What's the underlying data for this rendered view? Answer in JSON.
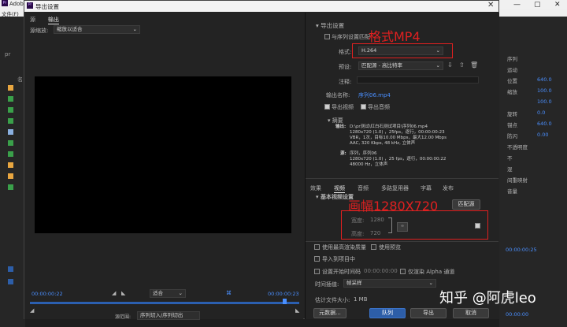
{
  "bg_window": {
    "title": "Adob",
    "menu": "文件(F)",
    "left_items": [
      "pr",
      "名"
    ],
    "right_items": [
      {
        "label": "序列",
        "value": ""
      },
      {
        "label": "运动",
        "value": ""
      },
      {
        "label": "位置",
        "value": "640.0"
      },
      {
        "label": "缩放",
        "value": "100.0"
      },
      {
        "label": "",
        "value": "100.0"
      },
      {
        "label": "旋转",
        "value": "0.0"
      },
      {
        "label": "锚点",
        "value": "640.0"
      },
      {
        "label": "防闪",
        "value": "0.00"
      },
      {
        "label": "不透明度",
        "value": ""
      },
      {
        "label": "不",
        "value": ""
      },
      {
        "label": "混",
        "value": ""
      },
      {
        "label": "间重映射",
        "value": ""
      },
      {
        "label": "音量",
        "value": ""
      }
    ],
    "right_times": [
      "00:00:00:25",
      "00:00:00"
    ]
  },
  "dialog": {
    "title": "导出设置",
    "tabs": [
      "源",
      "输出"
    ],
    "source_scaling_label": "源缩放:",
    "source_scaling_value": "缩放以适合",
    "timecode_start": "00:00:00:22",
    "timecode_end": "00:00:00:23",
    "fit_value": "适合",
    "source_range_label": "源范围:",
    "source_range_value": "序列切入/序列切出"
  },
  "export": {
    "header": "导出设置",
    "match_sequence": "与序列设置匹配",
    "format_label": "格式:",
    "format_value": "H.264",
    "preset_label": "预设:",
    "preset_value": "匹配源 - 高比特率",
    "comment_label": "注释:",
    "output_name_label": "输出名称:",
    "output_name_value": "序列06.mp4",
    "export_video": "导出视频",
    "export_audio": "导出音频",
    "summary_header": "摘要",
    "summary_output_label": "输出:",
    "summary_output_lines": [
      "D:\\pr测试\\红白石测试项目\\序列06.mp4",
      "1280x720 (1.0) ，25fps，逐行，00:00:00:23",
      "VBR，1次，目标10.00 Mbps，最大12.00 Mbps",
      "AAC, 320 Kbps, 48  kHz, 立体声"
    ],
    "summary_source_label": "源:",
    "summary_source_lines": [
      "序列，序列06",
      "1280x720 (1.0) ，25 fps，逐行，00:00:00:22",
      "48000 Hz，立体声"
    ]
  },
  "settings_tabs": [
    "效果",
    "视频",
    "音频",
    "多路复用器",
    "字幕",
    "发布"
  ],
  "video_settings": {
    "header": "基本视频设置",
    "match_source_btn": "匹配源",
    "width_label": "宽度:",
    "width_value": "1280",
    "height_label": "高度:",
    "height_value": "720"
  },
  "options": {
    "max_render": "使用最高渲染质量",
    "use_preview": "使用预览",
    "import_project": "导入到项目中",
    "set_start_tc": "设置开始时间码",
    "start_tc_value": "00:00:00:00",
    "render_alpha": "仅渲染 Alpha 通道",
    "time_interp_label": "时间插值:",
    "time_interp_value": "帧采样",
    "file_size_label": "估计文件大小:",
    "file_size_value": "1 MB"
  },
  "buttons": {
    "metadata": "元数据...",
    "queue": "队列",
    "export": "导出",
    "cancel": "取消"
  },
  "annotations": {
    "format_note": "格式MP4",
    "size_note": "画幅1280X720"
  },
  "watermark": "知乎 @阿虎leo",
  "colors": {
    "accent_blue": "#4a8fff",
    "annotation_red": "#e02020",
    "timeline_blue": "#2b5fb0"
  }
}
